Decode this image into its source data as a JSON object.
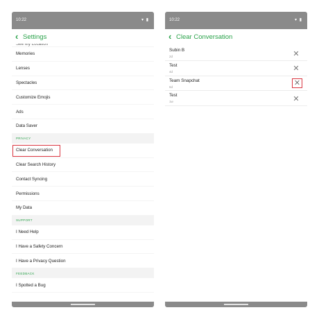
{
  "left_screen": {
    "status_bar": {
      "time": "10:22",
      "icons": "▾ ▮"
    },
    "header": {
      "title": "Settings"
    },
    "partial_item": "See My Location",
    "items_top": [
      "Memories",
      "Lenses",
      "Spectacles",
      "Customize Emojis",
      "Ads",
      "Data Saver"
    ],
    "section_privacy": "PRIVACY",
    "items_privacy": [
      "Clear Conversation",
      "Clear Search History",
      "Contact Syncing",
      "Permissions",
      "My Data"
    ],
    "section_support": "SUPPORT",
    "items_support": [
      "I Need Help",
      "I Have a Safety Concern",
      "I Have a Privacy Question"
    ],
    "section_feedback": "FEEDBACK",
    "items_feedback": [
      "I Spotted a Bug"
    ]
  },
  "right_screen": {
    "status_bar": {
      "time": "10:22",
      "icons": "▾ ▮"
    },
    "header": {
      "title": "Clear Conversation"
    },
    "conversations": [
      {
        "name": "Subin B",
        "time": "2d"
      },
      {
        "name": "Test",
        "time": "4d"
      },
      {
        "name": "Team Snapchat",
        "time": "6d"
      },
      {
        "name": "Test",
        "time": "1w"
      }
    ],
    "clear_glyph": "✕"
  },
  "colors": {
    "accent": "#2aa24a",
    "highlight": "#d9343f",
    "bar": "#8a8a8a"
  },
  "icons": {
    "back": "chevron-left-icon",
    "clear": "close-icon"
  }
}
